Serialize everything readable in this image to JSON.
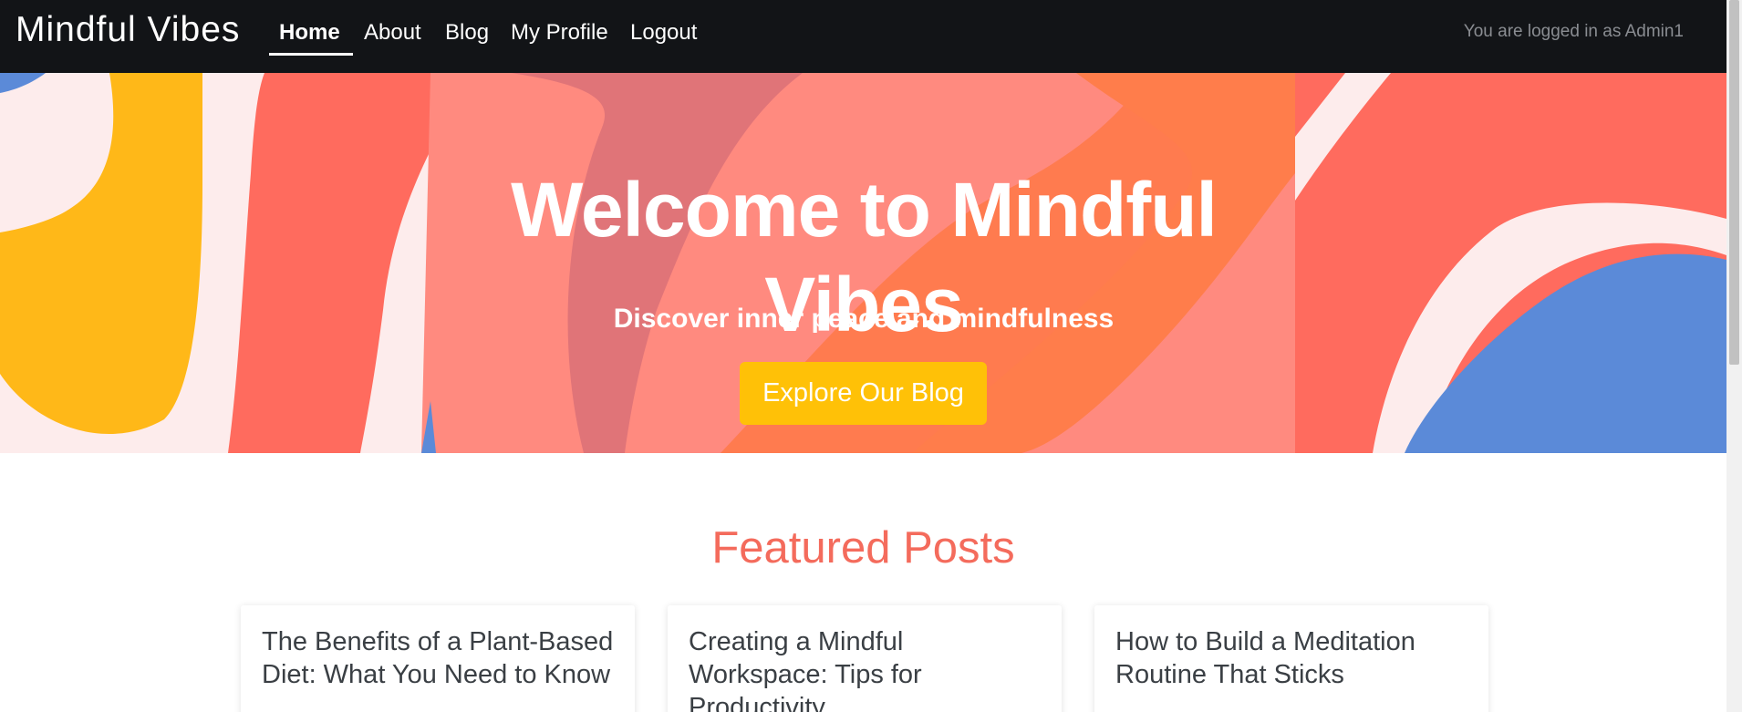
{
  "navbar": {
    "brand": "Mindful Vibes",
    "links": [
      "Home",
      "About",
      "Blog",
      "My Profile",
      "Logout"
    ],
    "active_link": "Home",
    "user_status": "You are logged in as Admin1"
  },
  "hero": {
    "title": "Welcome to Mindful Vibes",
    "subtitle": "Discover inner peace and mindfulness",
    "cta_label": "Explore Our Blog"
  },
  "featured": {
    "heading": "Featured Posts",
    "posts": [
      {
        "title": "The Benefits of a Plant-Based Diet: What You Need to Know"
      },
      {
        "title": "Creating a Mindful Workspace: Tips for Productivity"
      },
      {
        "title": "How to Build a Meditation Routine That Sticks"
      }
    ]
  },
  "colors": {
    "nav_bg": "#121417",
    "accent_coral": "#f46b5c",
    "cta_yellow": "#ffc107",
    "hero_yellow": "#ffb818",
    "hero_blue": "#5b8ad8",
    "hero_pink": "#fdecec"
  }
}
